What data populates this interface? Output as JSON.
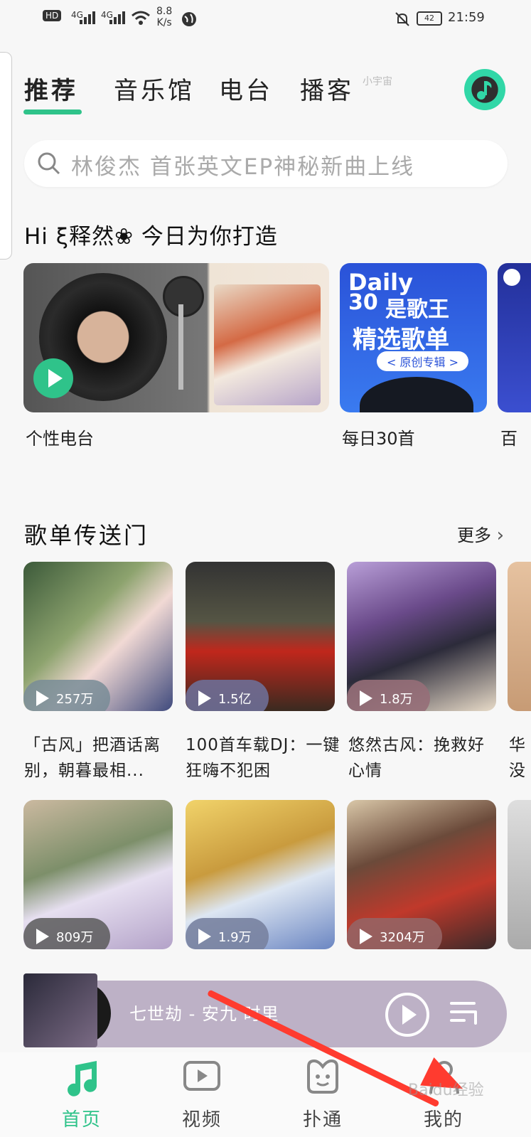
{
  "status_bar": {
    "hd": "HD",
    "net1": "4G",
    "net2": "4G",
    "speed_value": "8.8",
    "speed_unit": "K/s",
    "battery": "42",
    "time": "21:59"
  },
  "tabs": [
    {
      "label": "推荐",
      "active": true
    },
    {
      "label": "音乐馆"
    },
    {
      "label": "电台"
    },
    {
      "label": "播客"
    }
  ],
  "tab_extra": "小宇宙",
  "search": {
    "placeholder": "林俊杰 首张英文EP神秘新曲上线"
  },
  "greeting": "Hi ξ释然❀ 今日为你打造",
  "daily_cards": [
    {
      "label": "个性电台"
    },
    {
      "label": "每日30首",
      "cover_title_1": "Daily",
      "cover_title_2": "30",
      "cover_title_3": "是歌王",
      "cover_title_4": "精选歌单",
      "cover_chip": "< 原创专辑 >"
    },
    {
      "label": "百"
    }
  ],
  "section": {
    "title": "歌单传送门",
    "more": "更多"
  },
  "playlists_row1": [
    {
      "count": "257万",
      "title": "「古风」把酒话离别，朝暮最相..."
    },
    {
      "count": "1.5亿",
      "title": "100首车载DJ：一键狂嗨不犯困"
    },
    {
      "count": "1.8万",
      "title": "悠然古风：挽救好心情"
    },
    {
      "count": "",
      "title": "华 没"
    }
  ],
  "playlists_row2": [
    {
      "count": "809万"
    },
    {
      "count": "1.9万"
    },
    {
      "count": "3204万"
    },
    {
      "count": ""
    }
  ],
  "mini_player": {
    "track": "七世劫 - 安九 时里"
  },
  "bottom_nav": [
    {
      "label": "首页",
      "active": true
    },
    {
      "label": "视频"
    },
    {
      "label": "扑通"
    },
    {
      "label": "我的"
    }
  ],
  "watermark": "Baidu经验",
  "colors": {
    "accent": "#2fc38a",
    "annotation": "#ff3b2f"
  }
}
